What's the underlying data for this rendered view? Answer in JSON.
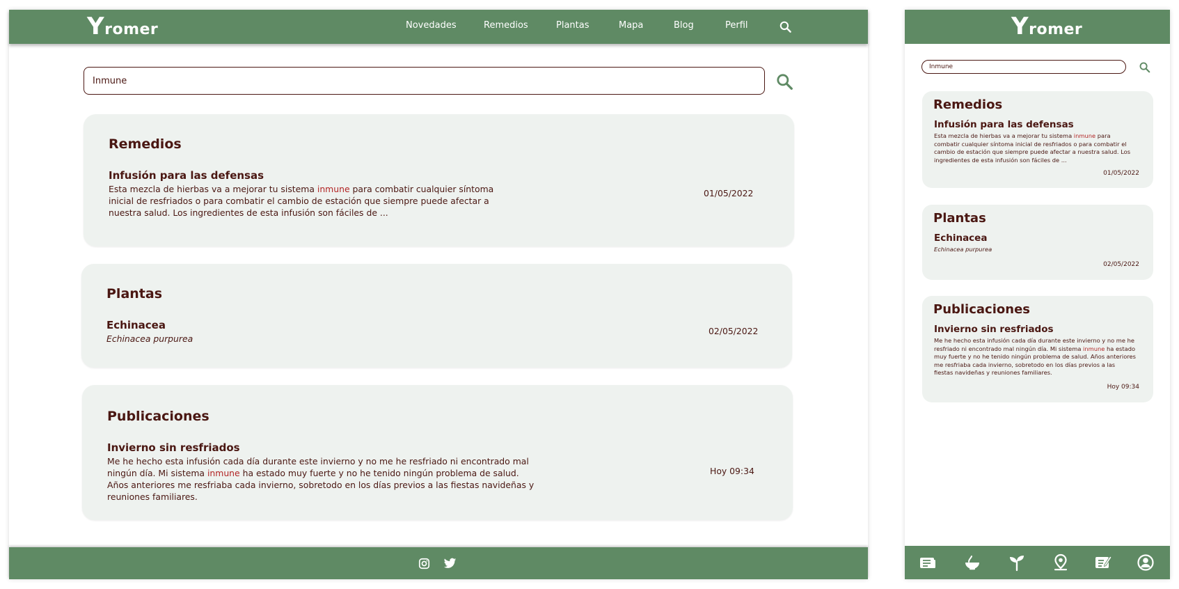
{
  "brand": {
    "logo_initial": "Y",
    "logo_rest": "romer"
  },
  "nav": {
    "items": [
      {
        "label": "Novedades"
      },
      {
        "label": "Remedios"
      },
      {
        "label": "Plantas"
      },
      {
        "label": "Mapa"
      },
      {
        "label": "Blog"
      },
      {
        "label": "Perfil"
      }
    ]
  },
  "search": {
    "value": "Inmune"
  },
  "results": {
    "remedios": {
      "heading": "Remedios",
      "title": "Infusión para las defensas",
      "text_before": "Esta mezcla de hierbas va a mejorar tu sistema ",
      "highlight": "inmune",
      "text_after": " para combatir cualquier síntoma inicial de resfriados o para combatir el cambio de estación que siempre puede afectar a nuestra salud. Los ingredientes de esta infusión son fáciles de ...",
      "date": "01/05/2022"
    },
    "plantas": {
      "heading": "Plantas",
      "title": "Echinacea",
      "subtitle": "Echinacea purpurea",
      "date": "02/05/2022"
    },
    "publicaciones": {
      "heading": "Publicaciones",
      "title": "Invierno sin resfriados",
      "text_before": "Me he hecho esta infusión cada día durante este invierno y no me he resfriado ni encontrado mal ningún día. Mi sistema ",
      "highlight": "inmune",
      "text_after": " ha estado muy fuerte y no he tenido ningún problema de salud. Años anteriores me resfriaba cada invierno, sobretodo en los días previos a las fiestas navideñas y reuniones familiares.",
      "date": "Hoy 09:34"
    }
  },
  "footer": {
    "icons": [
      "instagram-icon",
      "twitter-icon"
    ]
  },
  "mobile_tabbar": {
    "icons": [
      "news-icon",
      "remedies-bowl-icon",
      "plant-sprout-icon",
      "map-pin-icon",
      "blog-icon",
      "profile-icon"
    ]
  },
  "colors": {
    "primary_green": "#5f8a64",
    "card_bg": "#eef2ef",
    "text_brown": "#4a1712",
    "highlight_red": "#b22525"
  }
}
